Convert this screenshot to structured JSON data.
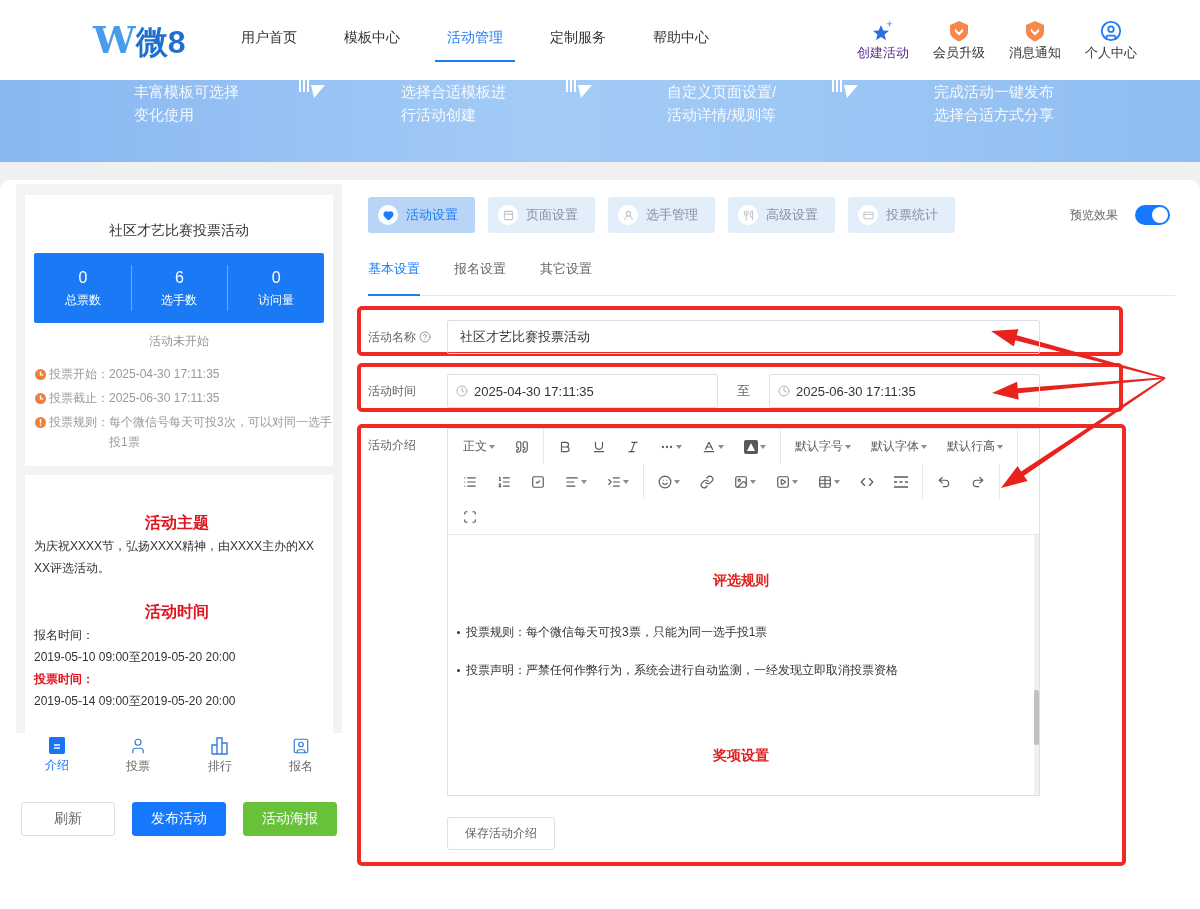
{
  "header": {
    "logo": {
      "mark": "W",
      "text": "微8"
    },
    "nav": [
      {
        "label": "用户首页",
        "selected": false
      },
      {
        "label": "模板中心",
        "selected": false
      },
      {
        "label": "活动管理",
        "selected": true
      },
      {
        "label": "定制服务",
        "selected": false
      },
      {
        "label": "帮助中心",
        "selected": false
      }
    ],
    "actions": [
      {
        "kind": "create",
        "label": "创建活动"
      },
      {
        "kind": "upgrade",
        "label": "会员升级"
      },
      {
        "kind": "notice",
        "label": "消息通知"
      },
      {
        "kind": "profile",
        "label": "个人中心"
      }
    ]
  },
  "banner": {
    "steps": [
      {
        "lines": [
          "丰富模板可选择",
          "变化使用"
        ]
      },
      {
        "lines": [
          "选择合适模板进",
          "行活动创建"
        ]
      },
      {
        "lines": [
          "自定义页面设置/",
          "活动详情/规则等"
        ]
      },
      {
        "lines": [
          "完成活动一键发布",
          "选择合适方式分享"
        ]
      }
    ]
  },
  "preview": {
    "title": "社区才艺比赛投票活动",
    "stats": [
      {
        "value": "0",
        "label": "总票数"
      },
      {
        "value": "6",
        "label": "选手数"
      },
      {
        "value": "0",
        "label": "访问量"
      }
    ],
    "status": "活动未开始",
    "info": [
      {
        "kind": "clock",
        "label": "投票开始：",
        "value": "2025-04-30 17:11:35"
      },
      {
        "kind": "clock",
        "label": "投票截止：",
        "value": "2025-06-30 17:11:35"
      },
      {
        "kind": "alert",
        "label": "投票规则：",
        "value": "每个微信号每天可投3次，可以对同一选手投1票"
      }
    ],
    "detail": [
      {
        "kind": "heading",
        "text": "活动主题"
      },
      {
        "kind": "text",
        "text": "为庆祝XXXX节，弘扬XXXX精神，由XXXX主办的XXXX评选活动。"
      },
      {
        "kind": "heading",
        "text": "活动时间"
      },
      {
        "kind": "text",
        "text": "报名时间："
      },
      {
        "kind": "text",
        "text": "2019-05-10 09:00至2019-05-20 20:00"
      },
      {
        "kind": "emphasis",
        "text": "投票时间："
      },
      {
        "kind": "text",
        "text": "2019-05-14 09:00至2019-05-20 20:00"
      }
    ],
    "tabbar": [
      {
        "kind": "intro",
        "label": "介绍",
        "selected": true
      },
      {
        "kind": "vote",
        "label": "投票",
        "selected": false
      },
      {
        "kind": "rank",
        "label": "排行",
        "selected": false
      },
      {
        "kind": "signup",
        "label": "报名",
        "selected": false
      }
    ],
    "buttons": [
      {
        "kind": "default",
        "label": "刷新"
      },
      {
        "kind": "primary",
        "label": "发布活动"
      },
      {
        "kind": "success",
        "label": "活动海报"
      }
    ]
  },
  "settings": {
    "tabs": [
      {
        "kind": "activity",
        "label": "活动设置",
        "selected": true
      },
      {
        "kind": "page",
        "label": "页面设置",
        "selected": false
      },
      {
        "kind": "player",
        "label": "选手管理",
        "selected": false
      },
      {
        "kind": "advanced",
        "label": "高级设置",
        "selected": false
      },
      {
        "kind": "stats",
        "label": "投票统计",
        "selected": false
      }
    ],
    "preview_toggle": {
      "label": "预览效果",
      "on": true
    },
    "subtabs": [
      {
        "label": "基本设置",
        "selected": true
      },
      {
        "label": "报名设置",
        "selected": false
      },
      {
        "label": "其它设置",
        "selected": false
      }
    ],
    "form": {
      "rows": [
        {
          "kind": "text",
          "label": "活动名称",
          "help": true,
          "value": "社区才艺比赛投票活动",
          "highlighted": true
        },
        {
          "kind": "daterange",
          "label": "活动时间",
          "start": "2025-04-30 17:11:35",
          "separator": "至",
          "end": "2025-06-30 17:11:35",
          "highlighted": true
        },
        {
          "kind": "editor",
          "label": "活动介绍",
          "highlighted": true,
          "save": "保存活动介绍",
          "toolbar": [
            [
              {
                "kind": "heading-select",
                "label": "正文",
                "dropdown": true
              },
              {
                "kind": "quote",
                "dropdown": false
              },
              {
                "kind": "divider"
              },
              {
                "kind": "bold",
                "dropdown": false
              },
              {
                "kind": "underline",
                "dropdown": false
              },
              {
                "kind": "italic",
                "dropdown": false
              },
              {
                "kind": "more",
                "dropdown": true
              },
              {
                "kind": "font-color",
                "dropdown": true
              },
              {
                "kind": "background-color",
                "dropdown": true
              },
              {
                "kind": "divider"
              },
              {
                "kind": "font-size",
                "label": "默认字号",
                "dropdown": true
              },
              {
                "kind": "font-family",
                "label": "默认字体",
                "dropdown": true
              },
              {
                "kind": "line-height",
                "label": "默认行高",
                "dropdown": true
              },
              {
                "kind": "divider"
              }
            ],
            [
              {
                "kind": "bulleted-list",
                "dropdown": false
              },
              {
                "kind": "numbered-list",
                "dropdown": false
              },
              {
                "kind": "todo",
                "dropdown": false
              },
              {
                "kind": "align",
                "dropdown": true
              },
              {
                "kind": "indent",
                "dropdown": true
              },
              {
                "kind": "divider"
              },
              {
                "kind": "emoji",
                "dropdown": true
              },
              {
                "kind": "link",
                "dropdown": false
              },
              {
                "kind": "image",
                "dropdown": true
              },
              {
                "kind": "video",
                "dropdown": true
              },
              {
                "kind": "table",
                "dropdown": true
              },
              {
                "kind": "code",
                "dropdown": false
              },
              {
                "kind": "horizontal-rule",
                "dropdown": false
              },
              {
                "kind": "divider"
              },
              {
                "kind": "undo",
                "dropdown": false
              },
              {
                "kind": "redo",
                "dropdown": false
              },
              {
                "kind": "divider"
              }
            ],
            [
              {
                "kind": "fullscreen",
                "dropdown": false
              }
            ]
          ],
          "content": [
            {
              "kind": "heading",
              "text": "评选规则"
            },
            {
              "kind": "bullet",
              "text": "投票规则：每个微信每天可投3票，只能为同一选手投1票"
            },
            {
              "kind": "bullet",
              "text": "投票声明：严禁任何作弊行为，系统会进行自动监测，一经发现立即取消投票资格"
            },
            {
              "kind": "heading",
              "text": "奖项设置"
            }
          ]
        }
      ]
    }
  }
}
